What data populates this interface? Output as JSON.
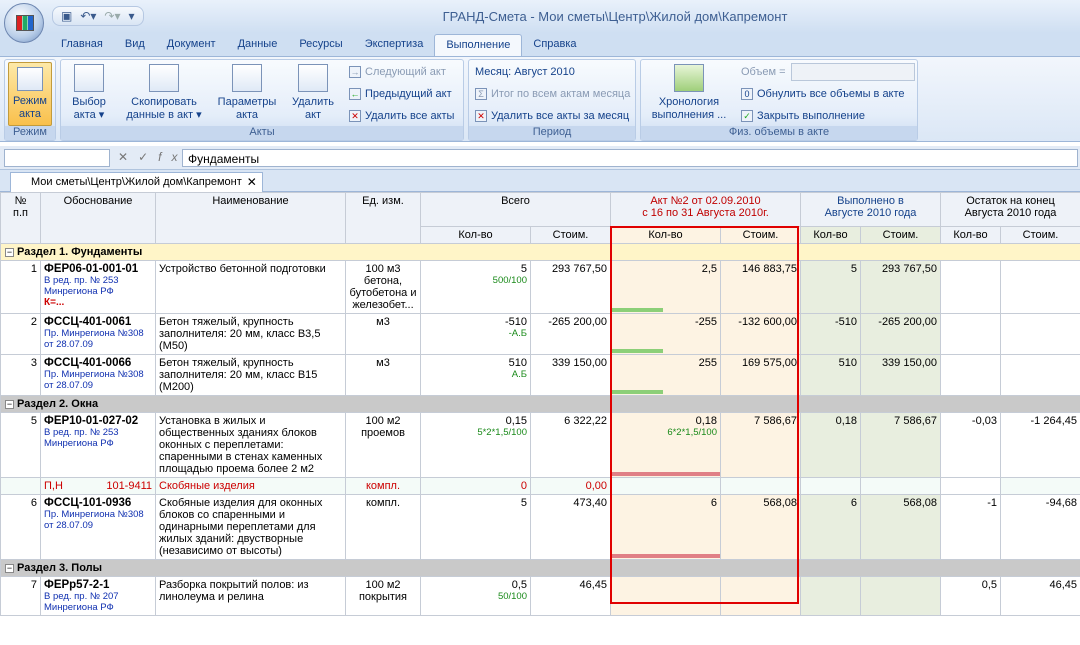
{
  "window": {
    "title": "ГРАНД-Смета - Мои сметы\\Центр\\Жилой дом\\Капремонт"
  },
  "tabs": [
    "Главная",
    "Вид",
    "Документ",
    "Данные",
    "Ресурсы",
    "Экспертиза",
    "Выполнение",
    "Справка"
  ],
  "active_tab": "Выполнение",
  "ribbon": {
    "mode": {
      "button": "Режим\nакта",
      "group": "Режим"
    },
    "acts": {
      "group": "Акты",
      "select": "Выбор\nакта ▾",
      "copy": "Скопировать\nданные в акт ▾",
      "params": "Параметры\nакта",
      "delete": "Удалить\nакт",
      "next": "Следующий акт",
      "prev": "Предыдущий акт",
      "delete_all": "Удалить все акты"
    },
    "period": {
      "group": "Период",
      "month": "Месяц: Август 2010",
      "total": "Итог по всем актам месяца",
      "delete_month": "Удалить все акты за месяц"
    },
    "phys": {
      "group": "Физ. объемы в акте",
      "chronology": "Хронология\nвыполнения ...",
      "volume_label": "Объем =",
      "reset": "Обнулить все объемы в акте",
      "close": "Закрыть выполнение"
    }
  },
  "formula_bar": {
    "value": "Фундаменты"
  },
  "doc_tab": "Мои сметы\\Центр\\Жилой дом\\Капремонт",
  "columns": {
    "num": "№\nп.п",
    "basis": "Обоснование",
    "name": "Наименование",
    "unit": "Ед. изм.",
    "total": "Всего",
    "act": "Акт №2 от 02.09.2010\nс 16 по 31 Августа 2010г.",
    "done": "Выполнено в\nАвгусте 2010 года",
    "rest": "Остаток на конец\nАвгуста 2010 года",
    "qty": "Кол-во",
    "cost": "Стоим."
  },
  "sections": [
    {
      "title": "Раздел 1. Фундаменты",
      "rows": [
        {
          "n": "1",
          "code": "ФЕР06-01-001-01",
          "note": "В ред. пр. № 253\nМинрегиона РФ",
          "extra": "К=...",
          "name": "Устройство бетонной подготовки",
          "unit": "100 м3\nбетона,\nбутобетона и\nжелезобет...",
          "tq": "5",
          "tq2": "500/100",
          "tc": "293 767,50",
          "aq": "2,5",
          "aq2": "",
          "ac": "146 883,75",
          "dq": "5",
          "dc": "293 767,50",
          "rq": "",
          "rc": "",
          "bar": "g",
          "bar_fill": 0.48
        },
        {
          "n": "2",
          "code": "ФССЦ-401-0061",
          "note": "Пр. Минрегиона №308\nот 28.07.09",
          "extra": "",
          "name": "Бетон тяжелый, крупность заполнителя: 20 мм, класс В3,5 (М50)",
          "unit": "м3",
          "tq": "-510",
          "tq2": "-А.Б",
          "tc": "-265 200,00",
          "aq": "-255",
          "aq2": "",
          "ac": "-132 600,00",
          "dq": "-510",
          "dc": "-265 200,00",
          "rq": "",
          "rc": "",
          "bar": "g",
          "bar_fill": 0.48
        },
        {
          "n": "3",
          "code": "ФССЦ-401-0066",
          "note": "Пр. Минрегиона №308\nот 28.07.09",
          "extra": "",
          "name": "Бетон тяжелый, крупность заполнителя: 20 мм, класс В15 (М200)",
          "unit": "м3",
          "tq": "510",
          "tq2": "А.Б",
          "tc": "339 150,00",
          "aq": "255",
          "aq2": "",
          "ac": "169 575,00",
          "dq": "510",
          "dc": "339 150,00",
          "rq": "",
          "rc": "",
          "bar": "g",
          "bar_fill": 0.48
        }
      ]
    },
    {
      "title": "Раздел 2. Окна",
      "rows": [
        {
          "n": "5",
          "code": "ФЕР10-01-027-02",
          "note": "В ред. пр. № 253\nМинрегиона РФ",
          "extra": "",
          "name": "Установка в жилых и общественных зданиях блоков оконных с переплетами: спаренными в стенах каменных площадью проема более 2 м2",
          "unit": "100 м2\nпроемов",
          "tq": "0,15",
          "tq2": "5*2*1,5/100",
          "tc": "6 322,22",
          "aq": "0,18",
          "aq2": "6*2*1,5/100",
          "ac": "7 586,67",
          "dq": "0,18",
          "dc": "7 586,67",
          "rq": "-0,03",
          "rc": "-1 264,45",
          "bar": "r",
          "bar_fill": 1.0
        },
        {
          "res": true,
          "code": "П,Н",
          "code2": "101-9411",
          "name": "Скобяные изделия",
          "unit": "компл.",
          "tq": "0",
          "tc": "0,00"
        },
        {
          "n": "6",
          "code": "ФССЦ-101-0936",
          "note": "Пр. Минрегиона №308\nот 28.07.09",
          "extra": "",
          "name": "Скобяные изделия для оконных блоков со спаренными и одинарными переплетами для жилых зданий: двустворные (независимо от высоты)",
          "unit": "компл.",
          "tq": "5",
          "tq2": "",
          "tc": "473,40",
          "aq": "6",
          "aq2": "",
          "ac": "568,08",
          "dq": "6",
          "dc": "568,08",
          "rq": "-1",
          "rc": "-94,68",
          "bar": "r",
          "bar_fill": 1.0
        }
      ]
    },
    {
      "title": "Раздел 3. Полы",
      "rows": [
        {
          "n": "7",
          "code": "ФЕРр57-2-1",
          "note": "В ред. пр. № 207\nМинрегиона РФ",
          "extra": "",
          "name": "Разборка покрытий полов: из линолеума и релина",
          "unit": "100 м2\nпокрытия",
          "tq": "0,5",
          "tq2": "50/100",
          "tc": "46,45",
          "aq": "",
          "aq2": "",
          "ac": "",
          "dq": "",
          "dc": "",
          "rq": "0,5",
          "rc": "46,45",
          "bar": "",
          "bar_fill": 0
        }
      ]
    }
  ]
}
